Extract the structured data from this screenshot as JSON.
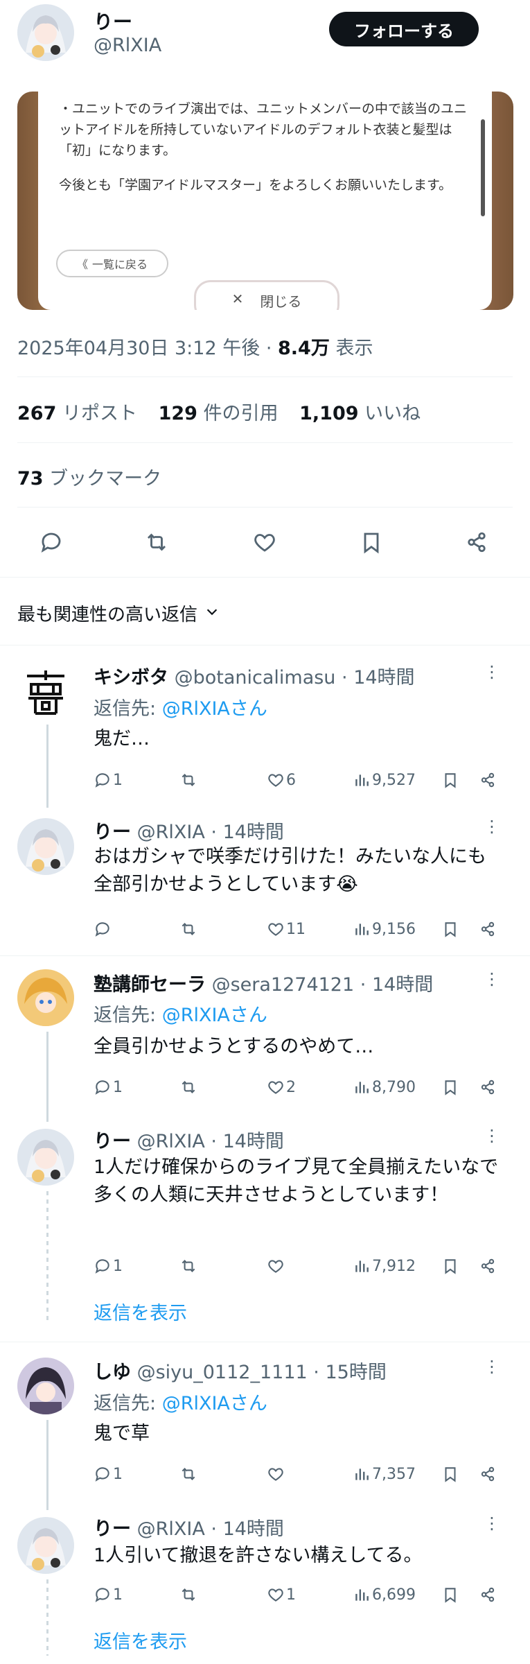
{
  "header": {
    "display_name": "りー",
    "handle": "@RlXIA",
    "follow_label": "フォローする"
  },
  "embed": {
    "paragraph1": "・ユニットでのライブ演出では、ユニットメンバーの中で該当のユニットアイドルを所持していないアイドルのデフォルト衣装と髪型は「初」になります。",
    "paragraph2": "今後とも「学園アイドルマスター」をよろしくお願いいたします。",
    "back_label": "一覧に戻る",
    "close_label": "閉じる"
  },
  "meta": {
    "timestamp": "2025年04月30日 3:12 午後",
    "dot": "·",
    "views_count": "8.4万",
    "views_label": "表示"
  },
  "stats": {
    "reposts_count": "267",
    "reposts_label": "リポスト",
    "quotes_count": "129",
    "quotes_label": "件の引用",
    "likes_count": "1,109",
    "likes_label": "いいね",
    "bookmarks_count": "73",
    "bookmarks_label": "ブックマーク"
  },
  "sort": {
    "label": "最も関連性の高い返信"
  },
  "replies": [
    {
      "name": "キシボタ",
      "handle": "@botanicalimasu",
      "dot": "·",
      "time": "14時間",
      "reply_prefix": "返信先:",
      "reply_target": "@RlXIAさん",
      "text": "鬼だ…",
      "replies": "1",
      "reposts": "",
      "likes": "6",
      "views": "9,527"
    },
    {
      "name": "りー",
      "handle": "@RlXIA",
      "dot": "·",
      "time": "14時間",
      "text": "おはガシャで咲季だけ引けた！みたいな人にも全部引かせようとしています😭",
      "replies": "",
      "reposts": "",
      "likes": "11",
      "views": "9,156"
    },
    {
      "name": "塾講師セーラ",
      "handle": "@sera1274121",
      "dot": "·",
      "time": "14時間",
      "reply_prefix": "返信先:",
      "reply_target": "@RlXIAさん",
      "text": "全員引かせようとするのやめて…",
      "replies": "1",
      "reposts": "",
      "likes": "2",
      "views": "8,790"
    },
    {
      "name": "りー",
      "handle": "@RlXIA",
      "dot": "·",
      "time": "14時間",
      "text": "1人だけ確保からのライブ見て全員揃えたいなで多くの人類に天井させようとしています！",
      "replies": "1",
      "reposts": "",
      "likes": "",
      "views": "7,912"
    },
    {
      "name": "しゆ",
      "handle": "@siyu_0112_1111",
      "dot": "·",
      "time": "15時間",
      "reply_prefix": "返信先:",
      "reply_target": "@RlXIAさん",
      "text": "鬼で草",
      "replies": "1",
      "reposts": "",
      "likes": "",
      "views": "7,357"
    },
    {
      "name": "りー",
      "handle": "@RlXIA",
      "dot": "·",
      "time": "14時間",
      "text": "1人引いて撤退を許さない構えしてる。",
      "replies": "1",
      "reposts": "",
      "likes": "1",
      "views": "6,699"
    }
  ],
  "show_replies_label": "返信を表示",
  "colors": {
    "accent": "#1d9bf0",
    "text": "#0f1419",
    "secondary": "#536471",
    "border": "#eff3f4"
  }
}
